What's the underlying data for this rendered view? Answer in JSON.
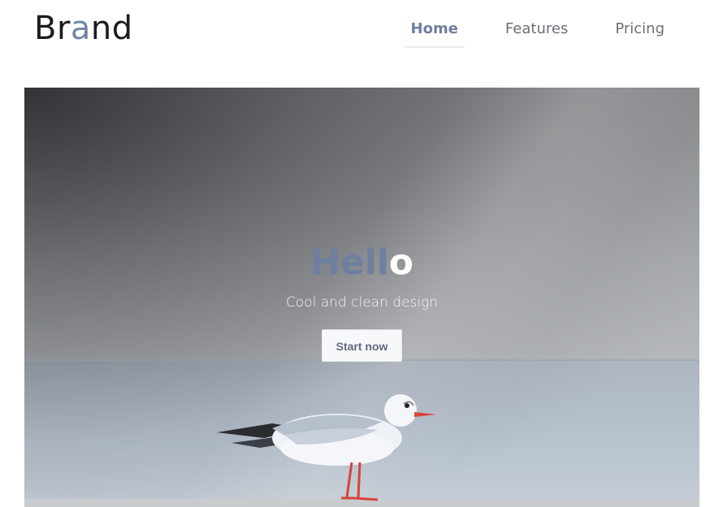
{
  "brand": {
    "prefix": "Br",
    "accent": "a",
    "suffix": "nd"
  },
  "nav": {
    "items": [
      {
        "label": "Home",
        "active": true
      },
      {
        "label": "Features",
        "active": false
      },
      {
        "label": "Pricing",
        "active": false
      }
    ]
  },
  "hero": {
    "title_main": "Hell",
    "title_last": "o",
    "subtitle": "Cool and clean design",
    "cta_label": "Start now",
    "image_subject": "seagull"
  },
  "colors": {
    "accent": "#6f7fa0",
    "text_dark": "#1c1c1c",
    "nav_text": "#6b6f75"
  }
}
